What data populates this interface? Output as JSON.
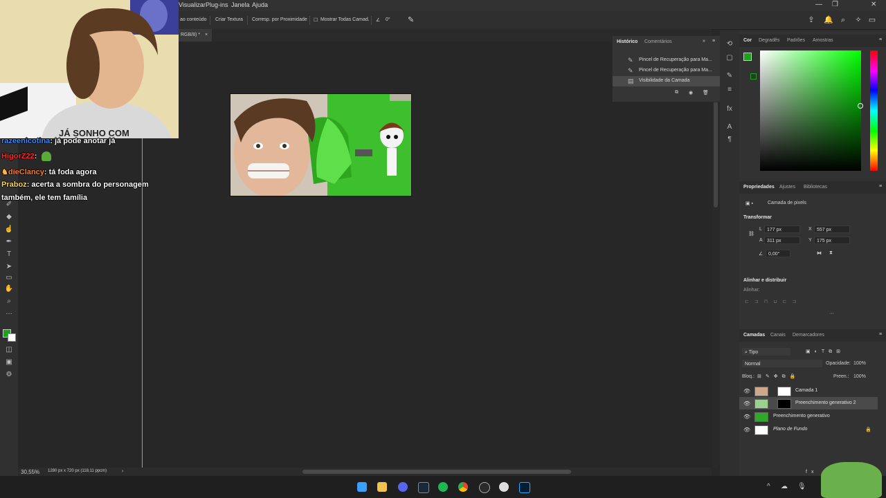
{
  "menu": {
    "items": [
      "Visualizar",
      "Plug-ins",
      "Janela",
      "Ajuda"
    ]
  },
  "options_bar": {
    "items": [
      "ao conteúdo",
      "Criar Textura",
      "Corresp. por Proximidade",
      "Mostrar Todas Camad."
    ],
    "angle": "0°"
  },
  "document_tab": {
    "label": "RGB/8) *",
    "close": "×"
  },
  "history": {
    "tabs": [
      "Histórico",
      "Comentários"
    ],
    "items": [
      "Pincel de Recuperação para Ma...",
      "Pincel de Recuperação para Ma...",
      "Visibilidade da Camada"
    ]
  },
  "color_panel": {
    "tabs": [
      "Cor",
      "Degradês",
      "Padrões",
      "Amostras"
    ],
    "foreground": "#19a319",
    "background": "#ffffff"
  },
  "properties": {
    "tabs": [
      "Propriedades",
      "Ajustes",
      "Bibliotecas"
    ],
    "layer_type": "Camada de pixels",
    "transform_title": "Transformar",
    "w_label": "L",
    "w_value": "177 px",
    "x_label": "X",
    "x_value": "557 px",
    "h_label": "A",
    "h_value": "311 px",
    "y_label": "Y",
    "y_value": "175 px",
    "angle_value": "0,00°",
    "align_title": "Alinhar e distribuir",
    "align_label": "Alinhar:"
  },
  "layers": {
    "tabs": [
      "Camadas",
      "Canais",
      "Demarcadores"
    ],
    "filter": "Tipo",
    "blend_mode": "Normal",
    "opacity_label": "Opacidade:",
    "opacity_value": "100%",
    "lock_label": "Bloq.:",
    "fill_label": "Preen.:",
    "fill_value": "100%",
    "items": [
      {
        "name": "Camada 1"
      },
      {
        "name": "Preenchimento generativo 2"
      },
      {
        "name": "Preenchimento generativo"
      },
      {
        "name": "Plano de Fundo"
      }
    ]
  },
  "status": {
    "zoom": "30,55%",
    "doc_info": "1280 px x 720 px (118,11 ppcm)"
  },
  "chat": [
    {
      "user": "razeenicotina",
      "color": "#3b8cff",
      "message": ": já pode anotar já"
    },
    {
      "user": "HigorZ22",
      "color": "#ff2a2a",
      "message": ":"
    },
    {
      "user": "dieClancy",
      "color": "#ff7f2a",
      "message": ": tá foda agora"
    },
    {
      "user": "Praboz",
      "color": "#ffd84a",
      "message": ": acerta a sombra do personagem"
    },
    {
      "user": "",
      "color": "#ffffff",
      "message": "também, ele tem família"
    }
  ],
  "webcam": {
    "shirt_text": "JÁ SONHO COM"
  }
}
